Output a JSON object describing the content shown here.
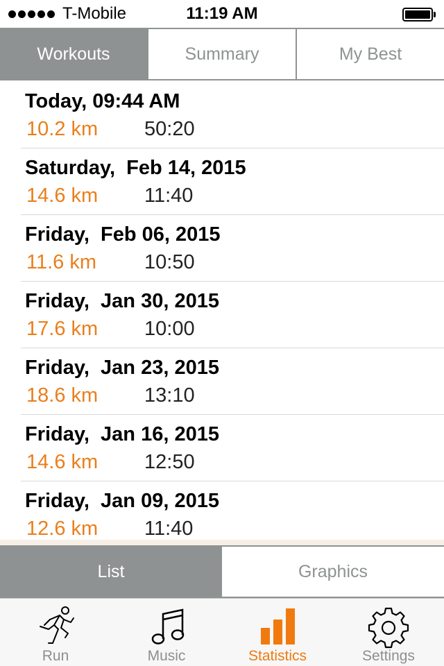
{
  "status_bar": {
    "carrier": "T-Mobile",
    "time": "11:19 AM"
  },
  "top_tabs": [
    {
      "label": "Workouts",
      "active": true
    },
    {
      "label": "Summary",
      "active": false
    },
    {
      "label": "My Best",
      "active": false
    }
  ],
  "workouts": [
    {
      "date": "Today, 09:44 AM",
      "distance": "10.2 km",
      "duration": "50:20"
    },
    {
      "date": "Saturday,  Feb 14, 2015",
      "distance": "14.6 km",
      "duration": "11:40"
    },
    {
      "date": "Friday,  Feb 06, 2015",
      "distance": "11.6 km",
      "duration": "10:50"
    },
    {
      "date": "Friday,  Jan 30, 2015",
      "distance": "17.6 km",
      "duration": "10:00"
    },
    {
      "date": "Friday,  Jan 23, 2015",
      "distance": "18.6 km",
      "duration": "13:10"
    },
    {
      "date": "Friday,  Jan 16, 2015",
      "distance": "14.6 km",
      "duration": "12:50"
    },
    {
      "date": "Friday,  Jan 09, 2015",
      "distance": "12.6 km",
      "duration": "11:40"
    }
  ],
  "view_tabs": [
    {
      "label": "List",
      "active": true
    },
    {
      "label": "Graphics",
      "active": false
    }
  ],
  "tab_bar": [
    {
      "label": "Run",
      "icon": "runner-icon",
      "active": false
    },
    {
      "label": "Music",
      "icon": "music-note-icon",
      "active": false
    },
    {
      "label": "Statistics",
      "icon": "bar-chart-icon",
      "active": true
    },
    {
      "label": "Settings",
      "icon": "gear-icon",
      "active": false
    }
  ],
  "colors": {
    "accent": "#e97f1c",
    "segment_gray": "#8e9293"
  }
}
